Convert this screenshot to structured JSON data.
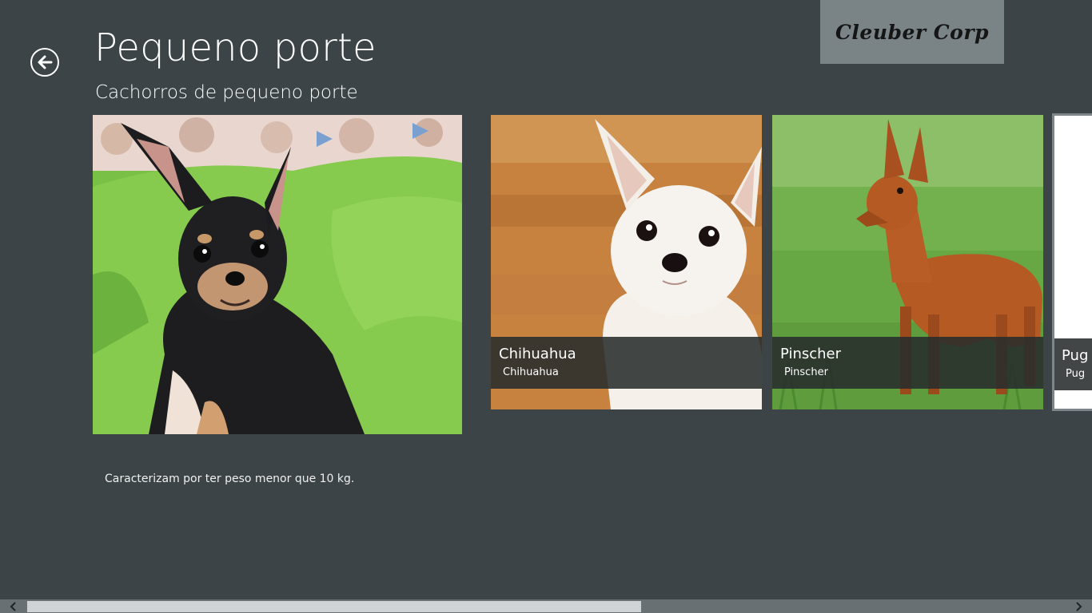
{
  "header": {
    "title": "Pequeno porte",
    "subtitle": "Cachorros de pequeno porte",
    "back_icon": "back-arrow-icon"
  },
  "brand": {
    "logo_text": "Cleuber Corp"
  },
  "main": {
    "description": "Caracterizam por ter peso menor que 10 kg."
  },
  "items": [
    {
      "title": "Chihuahua",
      "subtitle": "Chihuahua"
    },
    {
      "title": "Pinscher",
      "subtitle": "Pinscher"
    },
    {
      "title": "Pug",
      "subtitle": "Pug"
    }
  ],
  "scrollbar": {
    "left_icon": "chevron-left-icon",
    "right_icon": "chevron-right-icon"
  },
  "colors": {
    "background": "#3c4447",
    "logo_background": "#7a8386",
    "overlay": "#282c2c"
  }
}
